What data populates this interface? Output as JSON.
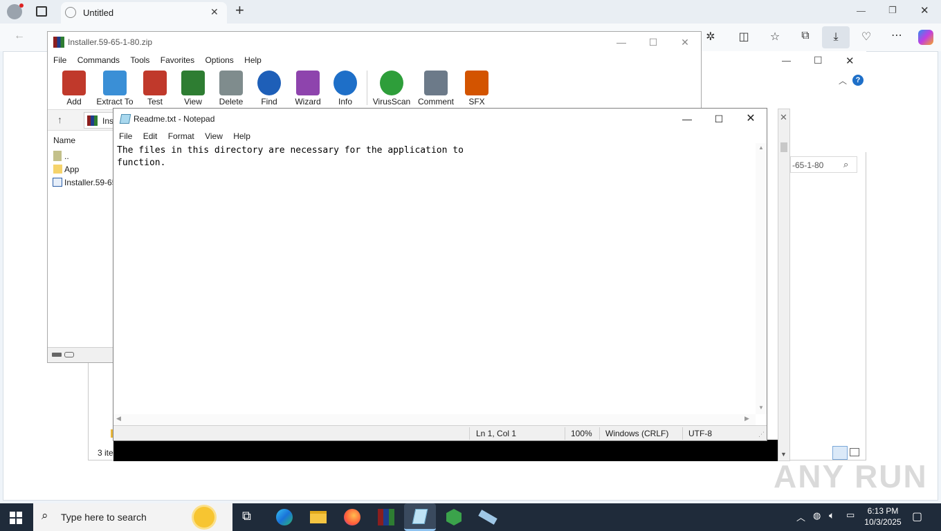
{
  "browser": {
    "tab_title": "Untitled",
    "new_tab": "+",
    "window_controls": [
      "—",
      "❐",
      "✕"
    ]
  },
  "winrar": {
    "title": "Installer.59-65-1-80.zip",
    "menu": [
      "File",
      "Commands",
      "Tools",
      "Favorites",
      "Options",
      "Help"
    ],
    "tools": [
      {
        "label": "Add",
        "color": "#c0392b"
      },
      {
        "label": "Extract To",
        "color": "#3a8fd6"
      },
      {
        "label": "Test",
        "color": "#c0392b"
      },
      {
        "label": "View",
        "color": "#2e7d32"
      },
      {
        "label": "Delete",
        "color": "#7f8c8d"
      },
      {
        "label": "Find",
        "color": "#1e5fb8"
      },
      {
        "label": "Wizard",
        "color": "#8e44ad"
      },
      {
        "label": "Info",
        "color": "#1e6fc8"
      },
      {
        "label": "VirusScan",
        "color": "#2e9e3a"
      },
      {
        "label": "Comment",
        "color": "#6c7a89"
      },
      {
        "label": "SFX",
        "color": "#d35400"
      }
    ],
    "path_prefix": "Ins",
    "column_name": "Name",
    "files": [
      {
        "name": "..",
        "icon": "folder-up"
      },
      {
        "name": "App",
        "icon": "folder"
      },
      {
        "name": "Installer.59-65",
        "icon": "file"
      }
    ]
  },
  "explorer": {
    "search_text": "-65-1-80",
    "status": "3 ite"
  },
  "notepad": {
    "title": "Readme.txt - Notepad",
    "menu": [
      "File",
      "Edit",
      "Format",
      "View",
      "Help"
    ],
    "content": "The files in this directory are necessary for the application to\nfunction.",
    "status": {
      "position": "Ln 1, Col 1",
      "zoom": "100%",
      "line_ending": "Windows (CRLF)",
      "encoding": "UTF-8"
    }
  },
  "taskbar": {
    "search_placeholder": "Type here to search",
    "time": "6:13 PM",
    "date": "10/3/2025"
  },
  "watermark": "ANY RUN"
}
